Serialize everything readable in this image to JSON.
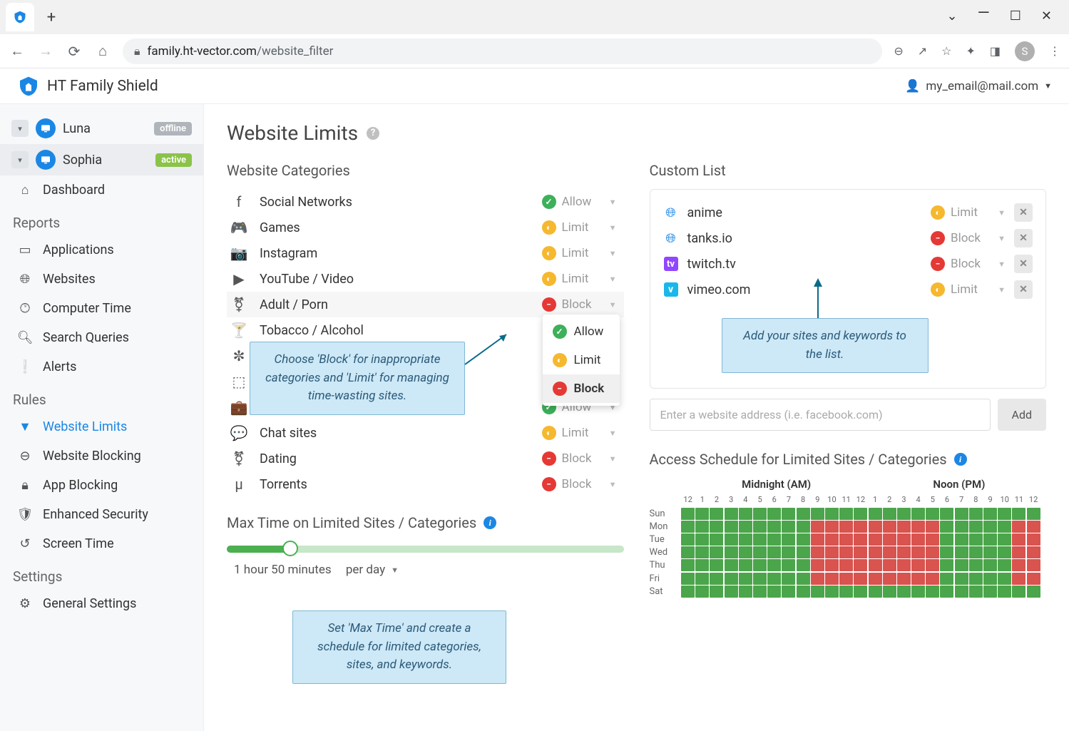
{
  "browser": {
    "url_domain": "family.ht-vector.com",
    "url_path": "/website_filter",
    "avatar_letter": "S"
  },
  "app": {
    "title": "HT Family Shield",
    "user_email": "my_email@mail.com"
  },
  "sidebar": {
    "users": [
      {
        "name": "Luna",
        "status": "offline"
      },
      {
        "name": "Sophia",
        "status": "active"
      }
    ],
    "nav_dashboard": "Dashboard",
    "section_reports": "Reports",
    "reports": [
      {
        "label": "Applications"
      },
      {
        "label": "Websites"
      },
      {
        "label": "Computer Time"
      },
      {
        "label": "Search Queries"
      },
      {
        "label": "Alerts"
      }
    ],
    "section_rules": "Rules",
    "rules": [
      {
        "label": "Website Limits",
        "active": true
      },
      {
        "label": "Website Blocking"
      },
      {
        "label": "App Blocking"
      },
      {
        "label": "Enhanced Security"
      },
      {
        "label": "Screen Time"
      }
    ],
    "section_settings": "Settings",
    "settings": [
      {
        "label": "General Settings"
      }
    ]
  },
  "main": {
    "page_title": "Website Limits",
    "categories_title": "Website Categories",
    "categories": [
      {
        "name": "Social Networks",
        "action": "Allow"
      },
      {
        "name": "Games",
        "action": "Limit"
      },
      {
        "name": "Instagram",
        "action": "Limit"
      },
      {
        "name": "YouTube / Video",
        "action": "Limit"
      },
      {
        "name": "Adult / Porn",
        "action": "Block",
        "open": true
      },
      {
        "name": "Tobacco / Alcohol",
        "action": ""
      },
      {
        "name": "",
        "action": ""
      },
      {
        "name": "",
        "action": ""
      },
      {
        "name": "",
        "action": "Allow"
      },
      {
        "name": "Chat sites",
        "action": "Limit"
      },
      {
        "name": "Dating",
        "action": "Block"
      },
      {
        "name": "Torrents",
        "action": "Block"
      }
    ],
    "dropdown": {
      "allow": "Allow",
      "limit": "Limit",
      "block": "Block"
    },
    "tooltip_categories": "Choose 'Block' for inappropriate categories and 'Limit' for managing time-wasting sites.",
    "custom_title": "Custom List",
    "custom_items": [
      {
        "site": "anime",
        "action": "Limit",
        "icon": "globe"
      },
      {
        "site": "tanks.io",
        "action": "Block",
        "icon": "globe"
      },
      {
        "site": "twitch.tv",
        "action": "Block",
        "icon": "twitch"
      },
      {
        "site": "vimeo.com",
        "action": "Limit",
        "icon": "vimeo"
      }
    ],
    "tooltip_custom": "Add your sites and keywords to the list.",
    "add_placeholder": "Enter a website address (i.e. facebook.com)",
    "add_button": "Add",
    "maxtime_title": "Max Time on Limited Sites / Categories",
    "maxtime_value": "1 hour 50 minutes",
    "maxtime_unit": "per day",
    "tooltip_maxtime": "Set 'Max Time' and create a schedule for limited categories, sites, and keywords.",
    "schedule_title": "Access Schedule for Limited Sites / Categories",
    "schedule_midnight": "Midnight (AM)",
    "schedule_noon": "Noon (PM)",
    "schedule_hours": [
      "12",
      "1",
      "2",
      "3",
      "4",
      "5",
      "6",
      "7",
      "8",
      "9",
      "10",
      "11",
      "12",
      "1",
      "2",
      "3",
      "4",
      "5",
      "6",
      "7",
      "8",
      "9",
      "10",
      "11",
      "12"
    ],
    "schedule_days": [
      "Sun",
      "Mon",
      "Tue",
      "Wed",
      "Thu",
      "Fri",
      "Sat"
    ],
    "schedule_pattern_sun_sat": "ggggggggggggggggggggggggg",
    "schedule_pattern_weekday": "gggggggggrrrrrrrrrgggggrr"
  }
}
